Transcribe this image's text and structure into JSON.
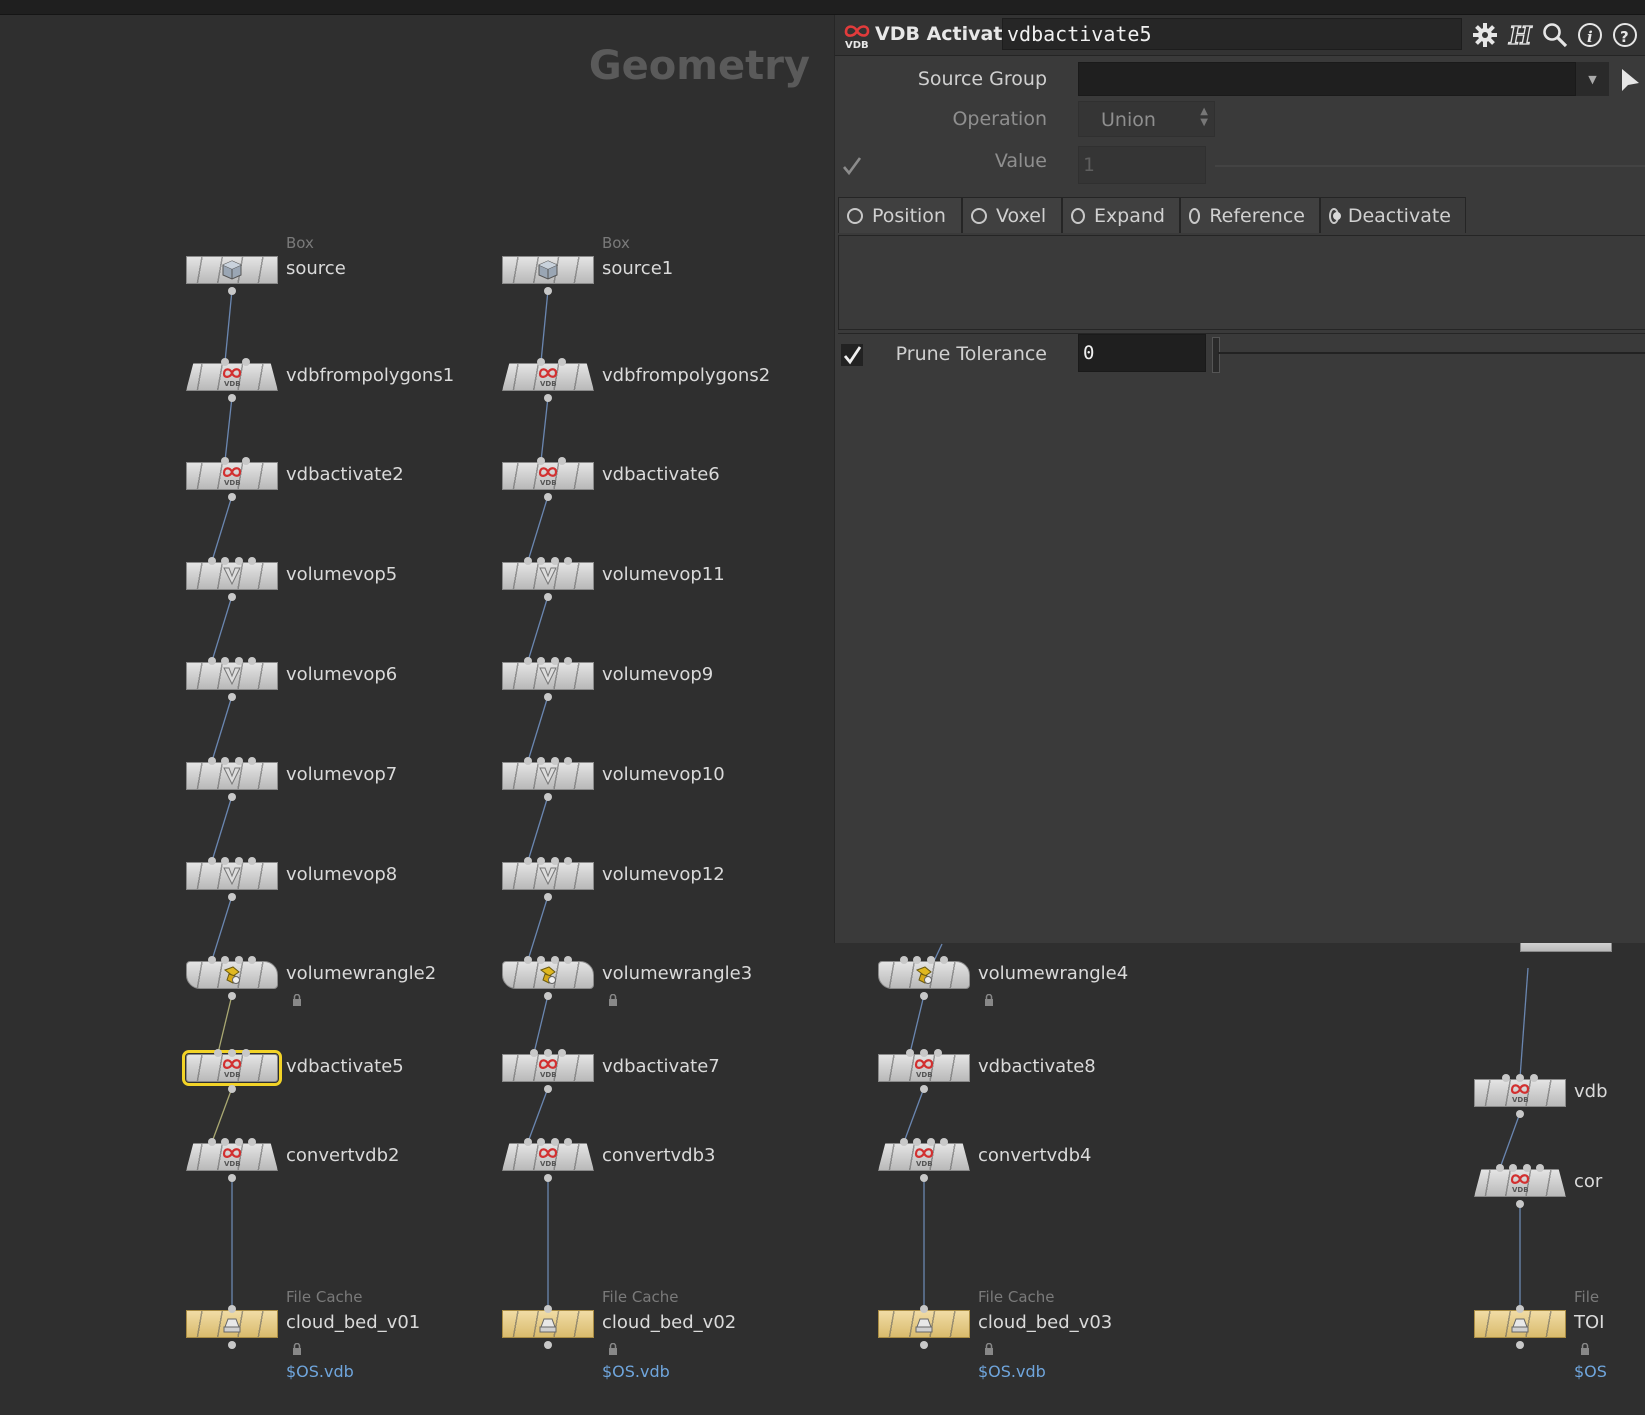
{
  "network": {
    "title": "Geometry",
    "nodes": {
      "source": {
        "type": "Box",
        "name": "source"
      },
      "source1": {
        "type": "Box",
        "name": "source1"
      },
      "vfp1": {
        "name": "vdbfrompolygons1"
      },
      "vfp2": {
        "name": "vdbfrompolygons2"
      },
      "va2": {
        "name": "vdbactivate2"
      },
      "va6": {
        "name": "vdbactivate6"
      },
      "vv5": {
        "name": "volumevop5"
      },
      "vv11": {
        "name": "volumevop11"
      },
      "vv6": {
        "name": "volumevop6"
      },
      "vv9": {
        "name": "volumevop9"
      },
      "vv7": {
        "name": "volumevop7"
      },
      "vv10": {
        "name": "volumevop10"
      },
      "vv8": {
        "name": "volumevop8"
      },
      "vv12": {
        "name": "volumevop12"
      },
      "vw2": {
        "name": "volumewrangle2"
      },
      "vw3": {
        "name": "volumewrangle3"
      },
      "vw4": {
        "name": "volumewrangle4"
      },
      "va5": {
        "name": "vdbactivate5"
      },
      "va7": {
        "name": "vdbactivate7"
      },
      "va8": {
        "name": "vdbactivate8"
      },
      "va_edge": {
        "name": "vdb"
      },
      "cv2": {
        "name": "convertvdb2"
      },
      "cv3": {
        "name": "convertvdb3"
      },
      "cv4": {
        "name": "convertvdb4"
      },
      "cv_edge": {
        "name": "cor"
      },
      "fc1": {
        "type": "File Cache",
        "name": "cloud_bed_v01",
        "path": "$OS.vdb"
      },
      "fc2": {
        "type": "File Cache",
        "name": "cloud_bed_v02",
        "path": "$OS.vdb"
      },
      "fc3": {
        "type": "File Cache",
        "name": "cloud_bed_v03",
        "path": "$OS.vdb"
      },
      "fc_edge": {
        "type": "File",
        "name": "TOI",
        "path": "$OS"
      }
    },
    "selected_node": "vdbactivate5",
    "colors": {
      "background": "#2f2f2f",
      "wire": "#6a86b0",
      "selected_wire": "#a9a872",
      "selection_outline": "#f2d327",
      "node_path": "#6fa5dc"
    }
  },
  "parameter_panel": {
    "header": {
      "node_type": "VDB Activate",
      "node_name": "vdbactivate5",
      "icon": "vdb-icon",
      "buttons": [
        "gear-icon",
        "help-h-icon",
        "search-icon",
        "info-icon",
        "question-icon"
      ]
    },
    "params": {
      "source_group": {
        "label": "Source Group",
        "value": ""
      },
      "operation": {
        "label": "Operation",
        "value": "Union"
      },
      "value": {
        "label": "Value",
        "value": "1",
        "checked": true
      },
      "prune_tolerance": {
        "label": "Prune Tolerance",
        "value": "0",
        "checked": true
      }
    },
    "tabs": [
      {
        "label": "Position",
        "selected": false
      },
      {
        "label": "Voxel",
        "selected": false
      },
      {
        "label": "Expand",
        "selected": false
      },
      {
        "label": "Reference",
        "selected": false
      },
      {
        "label": "Deactivate",
        "selected": true
      }
    ]
  }
}
